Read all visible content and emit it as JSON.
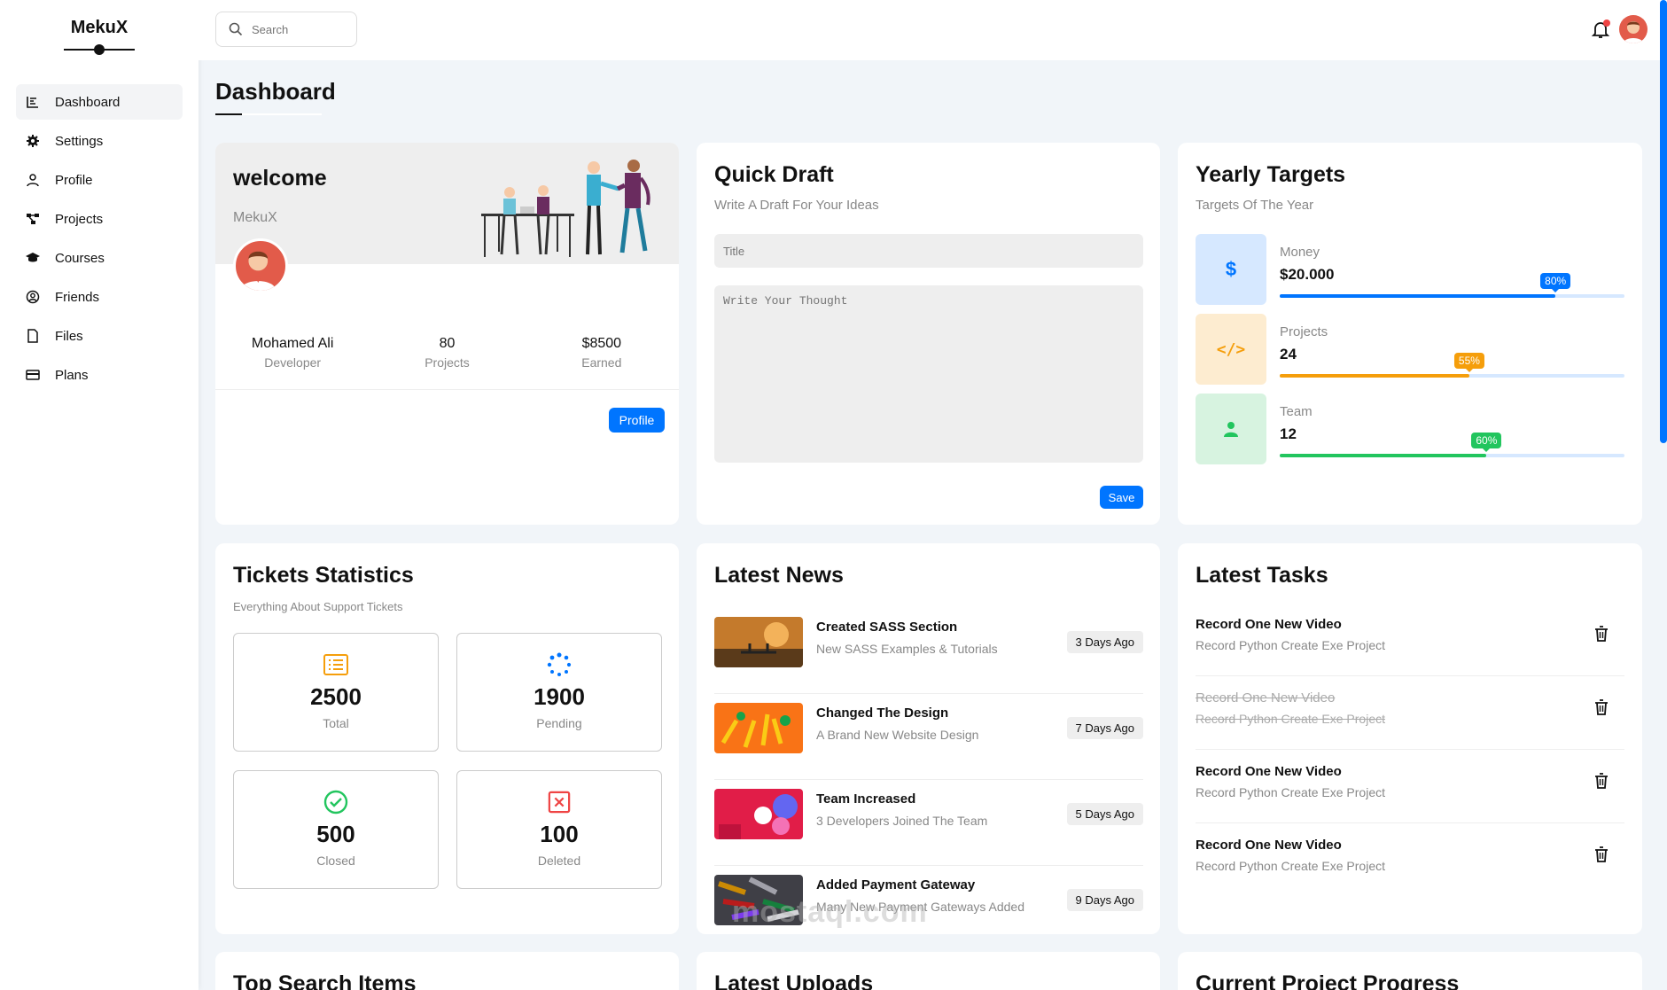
{
  "brand": {
    "name": "MekuX"
  },
  "sidebar": {
    "items": [
      {
        "label": "Dashboard",
        "icon": "chart-line-icon"
      },
      {
        "label": "Settings",
        "icon": "gear-icon"
      },
      {
        "label": "Profile",
        "icon": "user-icon"
      },
      {
        "label": "Projects",
        "icon": "diagram-icon"
      },
      {
        "label": "Courses",
        "icon": "graduation-cap-icon"
      },
      {
        "label": "Friends",
        "icon": "user-circle-icon"
      },
      {
        "label": "Files",
        "icon": "file-icon"
      },
      {
        "label": "Plans",
        "icon": "credit-card-icon"
      }
    ]
  },
  "header": {
    "search_placeholder": "Search"
  },
  "page": {
    "title": "Dashboard"
  },
  "welcome": {
    "title": "welcome",
    "brand": "MekuX",
    "stats": [
      {
        "value": "Mohamed Ali",
        "label": "Developer"
      },
      {
        "value": "80",
        "label": "Projects"
      },
      {
        "value": "$8500",
        "label": "Earned"
      }
    ],
    "button": "Profile"
  },
  "draft": {
    "title": "Quick Draft",
    "subtitle": "Write A Draft For Your Ideas",
    "title_placeholder": "Title",
    "body_placeholder": "Write Your Thought",
    "button": "Save"
  },
  "targets": {
    "title": "Yearly Targets",
    "subtitle": "Targets Of The Year",
    "items": [
      {
        "label": "Money",
        "value": "$20.000",
        "percent": 80,
        "percent_label": "80%",
        "color": "#0075ff",
        "bg": "#d6e8ff",
        "icon_text": "$"
      },
      {
        "label": "Projects",
        "value": "24",
        "percent": 55,
        "percent_label": "55%",
        "color": "#f59e0b",
        "bg": "#fdecd0",
        "icon_text": "</>"
      },
      {
        "label": "Team",
        "value": "12",
        "percent": 60,
        "percent_label": "60%",
        "color": "#22c55e",
        "bg": "#d7f3e0",
        "icon_text": ""
      }
    ],
    "track_color": "#d6e8ff"
  },
  "tickets": {
    "title": "Tickets Statistics",
    "subtitle": "Everything About Support Tickets",
    "items": [
      {
        "value": "2500",
        "label": "Total",
        "icon": "list-icon",
        "color": "#f59e0b"
      },
      {
        "value": "1900",
        "label": "Pending",
        "icon": "spinner-icon",
        "color": "#0075ff"
      },
      {
        "value": "500",
        "label": "Closed",
        "icon": "check-circle-icon",
        "color": "#22c55e"
      },
      {
        "value": "100",
        "label": "Deleted",
        "icon": "x-square-icon",
        "color": "#ef4444"
      }
    ]
  },
  "news": {
    "title": "Latest News",
    "items": [
      {
        "title": "Created SASS Section",
        "desc": "New SASS Examples & Tutorials",
        "ago": "3 Days Ago"
      },
      {
        "title": "Changed The Design",
        "desc": "A Brand New Website Design",
        "ago": "7 Days Ago"
      },
      {
        "title": "Team Increased",
        "desc": "3 Developers Joined The Team",
        "ago": "5 Days Ago"
      },
      {
        "title": "Added Payment Gateway",
        "desc": "Many New Payment Gateways Added",
        "ago": "9 Days Ago"
      }
    ]
  },
  "tasks": {
    "title": "Latest Tasks",
    "items": [
      {
        "title": "Record One New Video",
        "desc": "Record Python Create Exe Project",
        "done": false
      },
      {
        "title": "Record One New Video",
        "desc": "Record Python Create Exe Project",
        "done": true
      },
      {
        "title": "Record One New Video",
        "desc": "Record Python Create Exe Project",
        "done": false
      },
      {
        "title": "Record One New Video",
        "desc": "Record Python Create Exe Project",
        "done": false
      }
    ]
  },
  "bottom": {
    "titles": [
      "Top Search Items",
      "Latest Uploads",
      "Current Project Progress"
    ]
  },
  "watermark": "mostaql.com"
}
